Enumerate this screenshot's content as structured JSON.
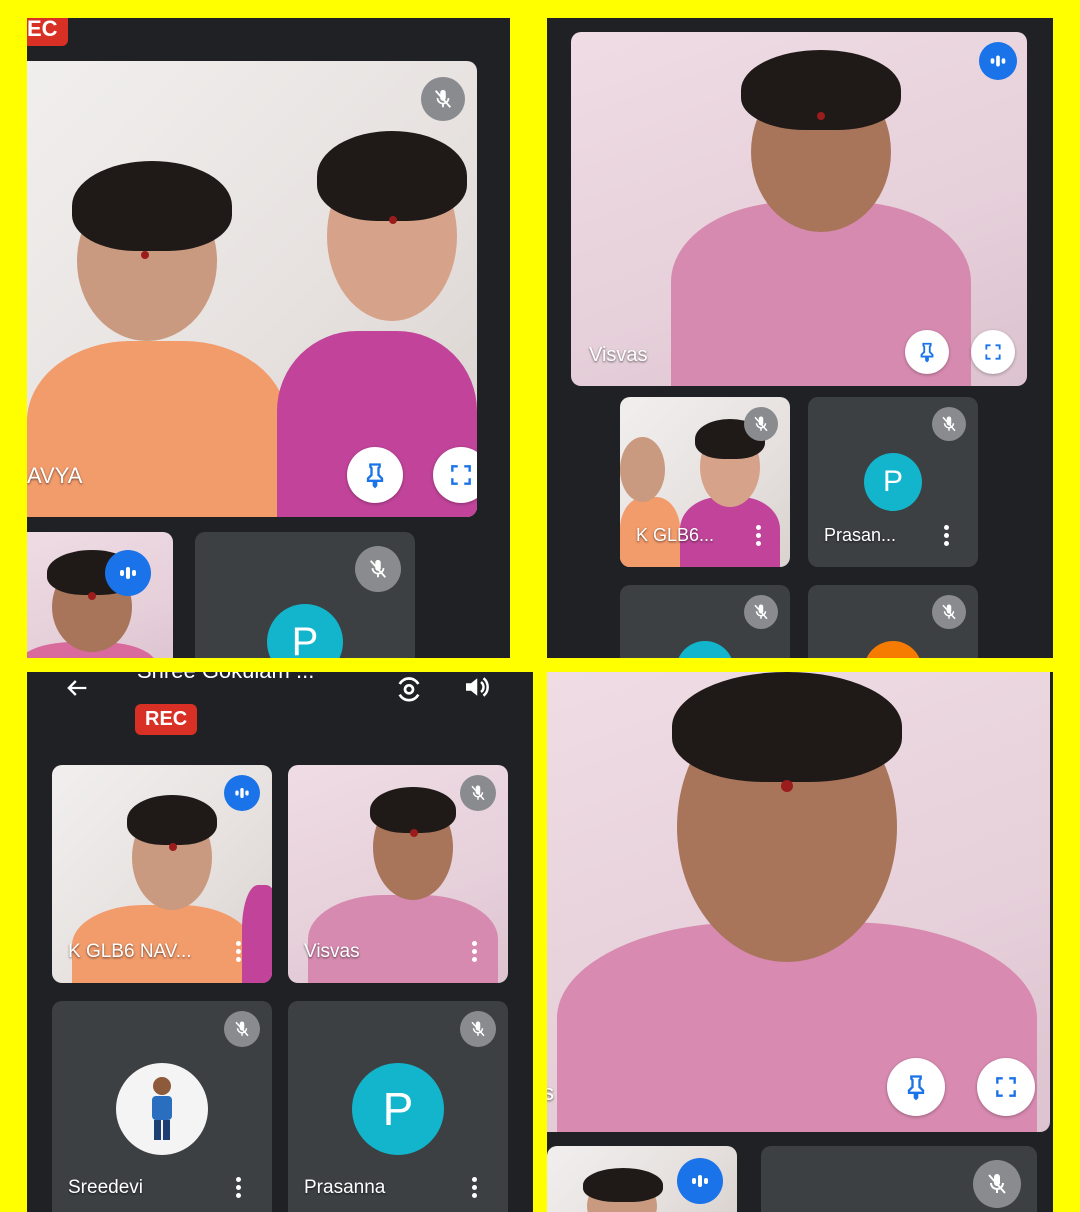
{
  "panel_tl": {
    "rec_label": "EC",
    "main_name": "AVYA",
    "second_avatar_letter": "P"
  },
  "panel_tr": {
    "main_name": "Visvas",
    "tile1_name": "K GLB6...",
    "tile2_name": "Prasan...",
    "tile2_avatar_letter": "P"
  },
  "panel_bl": {
    "header_title": "Shree Gokulam ...",
    "rec_label": "REC",
    "tiles": [
      {
        "name": "K GLB6 NAV..."
      },
      {
        "name": "Visvas"
      },
      {
        "name": "Sreedevi"
      },
      {
        "name": "Prasanna",
        "avatar_letter": "P"
      }
    ]
  },
  "panel_br": {
    "edge_char": "s"
  },
  "colors": {
    "frame": "#ffff00",
    "panel_bg": "#202124",
    "tile_bg": "#3c4043",
    "speaking_blue": "#1a73e8",
    "avatar_teal": "#12b5cb",
    "avatar_orange": "#f57c00",
    "rec_red": "#d93025"
  },
  "icons": [
    "mic-off-icon",
    "speaking-indicator-icon",
    "pin-icon",
    "fullscreen-icon",
    "more-vert-icon",
    "back-arrow-icon",
    "switch-camera-icon",
    "speaker-icon"
  ]
}
